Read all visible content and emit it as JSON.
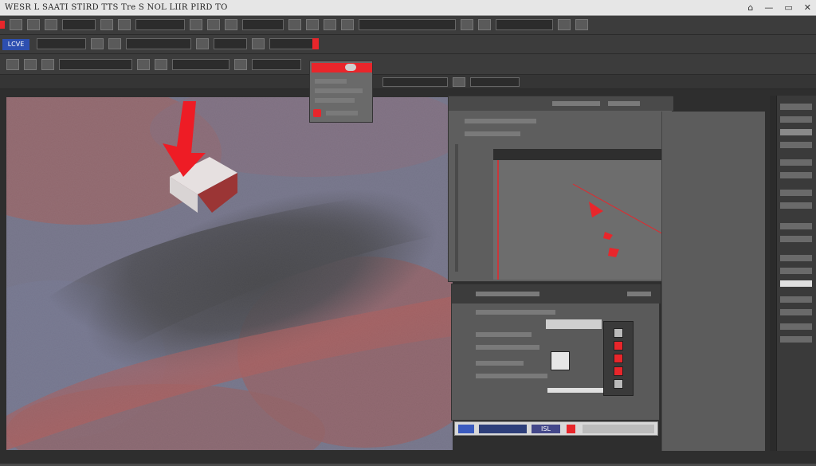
{
  "menubar": {
    "title_text": "WESR L SAATI STIRD  TTS Tre S NOL LIIR  PIRD TO",
    "right_icons": [
      "home-icon",
      "minimize-icon",
      "restore-icon",
      "close-icon"
    ],
    "right_glyphs": [
      "⌂",
      "—",
      "▭",
      "✕"
    ]
  },
  "toolbar1": {
    "preset_label": "LCVE"
  },
  "colors": {
    "accent_red": "#e8262b",
    "menubar_bg": "#e6e6e6",
    "panel_bg": "#5a5a5a",
    "toolbar_bg": "#3c3c3c",
    "preset_blue": "#2d4fb0"
  },
  "status_strip": {
    "label": "ISL"
  }
}
